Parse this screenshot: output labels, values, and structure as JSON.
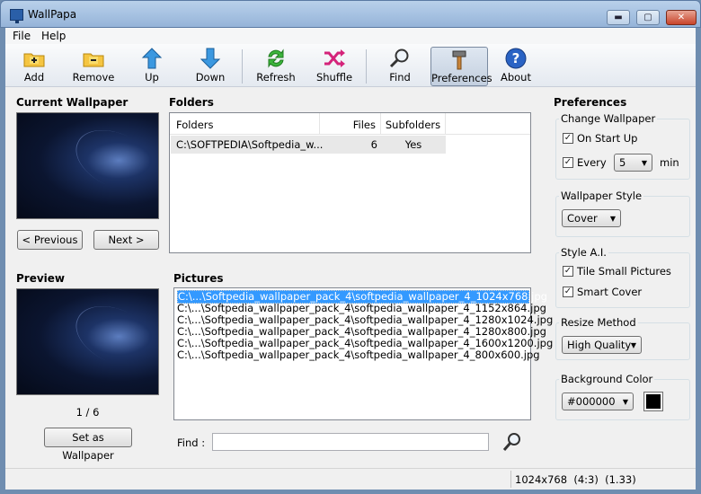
{
  "window": {
    "title": "WallPapa",
    "min_glyph": "▬",
    "max_glyph": "▢",
    "close_glyph": "✕"
  },
  "menu": [
    "File",
    "Help"
  ],
  "toolbar": {
    "add": "Add",
    "remove": "Remove",
    "up": "Up",
    "down": "Down",
    "refresh": "Refresh",
    "shuffle": "Shuffle",
    "find": "Find",
    "preferences": "Preferences",
    "about": "About"
  },
  "current_wallpaper": {
    "title": "Current Wallpaper",
    "prev": "< Previous",
    "next": "Next >"
  },
  "preview": {
    "title": "Preview",
    "counter": "1 / 6",
    "set_button": "Set as Wallpaper"
  },
  "folders": {
    "title": "Folders",
    "columns": [
      "Folders",
      "Files",
      "Subfolders"
    ],
    "row": {
      "path": "C:\\SOFTPEDIA\\Softpedia_w...",
      "files": "6",
      "subfolders": "Yes"
    }
  },
  "pictures": {
    "title": "Pictures",
    "items": [
      "C:\\...\\Softpedia_wallpaper_pack_4\\softpedia_wallpaper_4_1024x768.jpg",
      "C:\\...\\Softpedia_wallpaper_pack_4\\softpedia_wallpaper_4_1152x864.jpg",
      "C:\\...\\Softpedia_wallpaper_pack_4\\softpedia_wallpaper_4_1280x1024.jpg",
      "C:\\...\\Softpedia_wallpaper_pack_4\\softpedia_wallpaper_4_1280x800.jpg",
      "C:\\...\\Softpedia_wallpaper_pack_4\\softpedia_wallpaper_4_1600x1200.jpg",
      "C:\\...\\Softpedia_wallpaper_pack_4\\softpedia_wallpaper_4_800x600.jpg"
    ],
    "selected_index": 0
  },
  "find": {
    "label": "Find :",
    "value": ""
  },
  "preferences": {
    "title": "Preferences",
    "change_wallpaper": {
      "title": "Change Wallpaper",
      "on_startup": "On Start Up",
      "every": "Every",
      "minutes": "5",
      "unit": "min"
    },
    "style": {
      "title": "Wallpaper Style",
      "value": "Cover"
    },
    "style_ai": {
      "title": "Style A.I.",
      "tile_small": "Tile Small Pictures",
      "smart_cover": "Smart Cover"
    },
    "resize": {
      "title": "Resize Method",
      "value": "High Quality"
    },
    "background": {
      "title": "Background Color",
      "value": "#000000",
      "swatch": "#000000"
    },
    "check_mark": "✓",
    "dropdown_arrow": "▼"
  },
  "statusbar": {
    "text": "1024x768  (4:3)  (1.33)"
  },
  "colors": {
    "selection": "#3399ff",
    "title_gradient": "#a9c4e3"
  }
}
